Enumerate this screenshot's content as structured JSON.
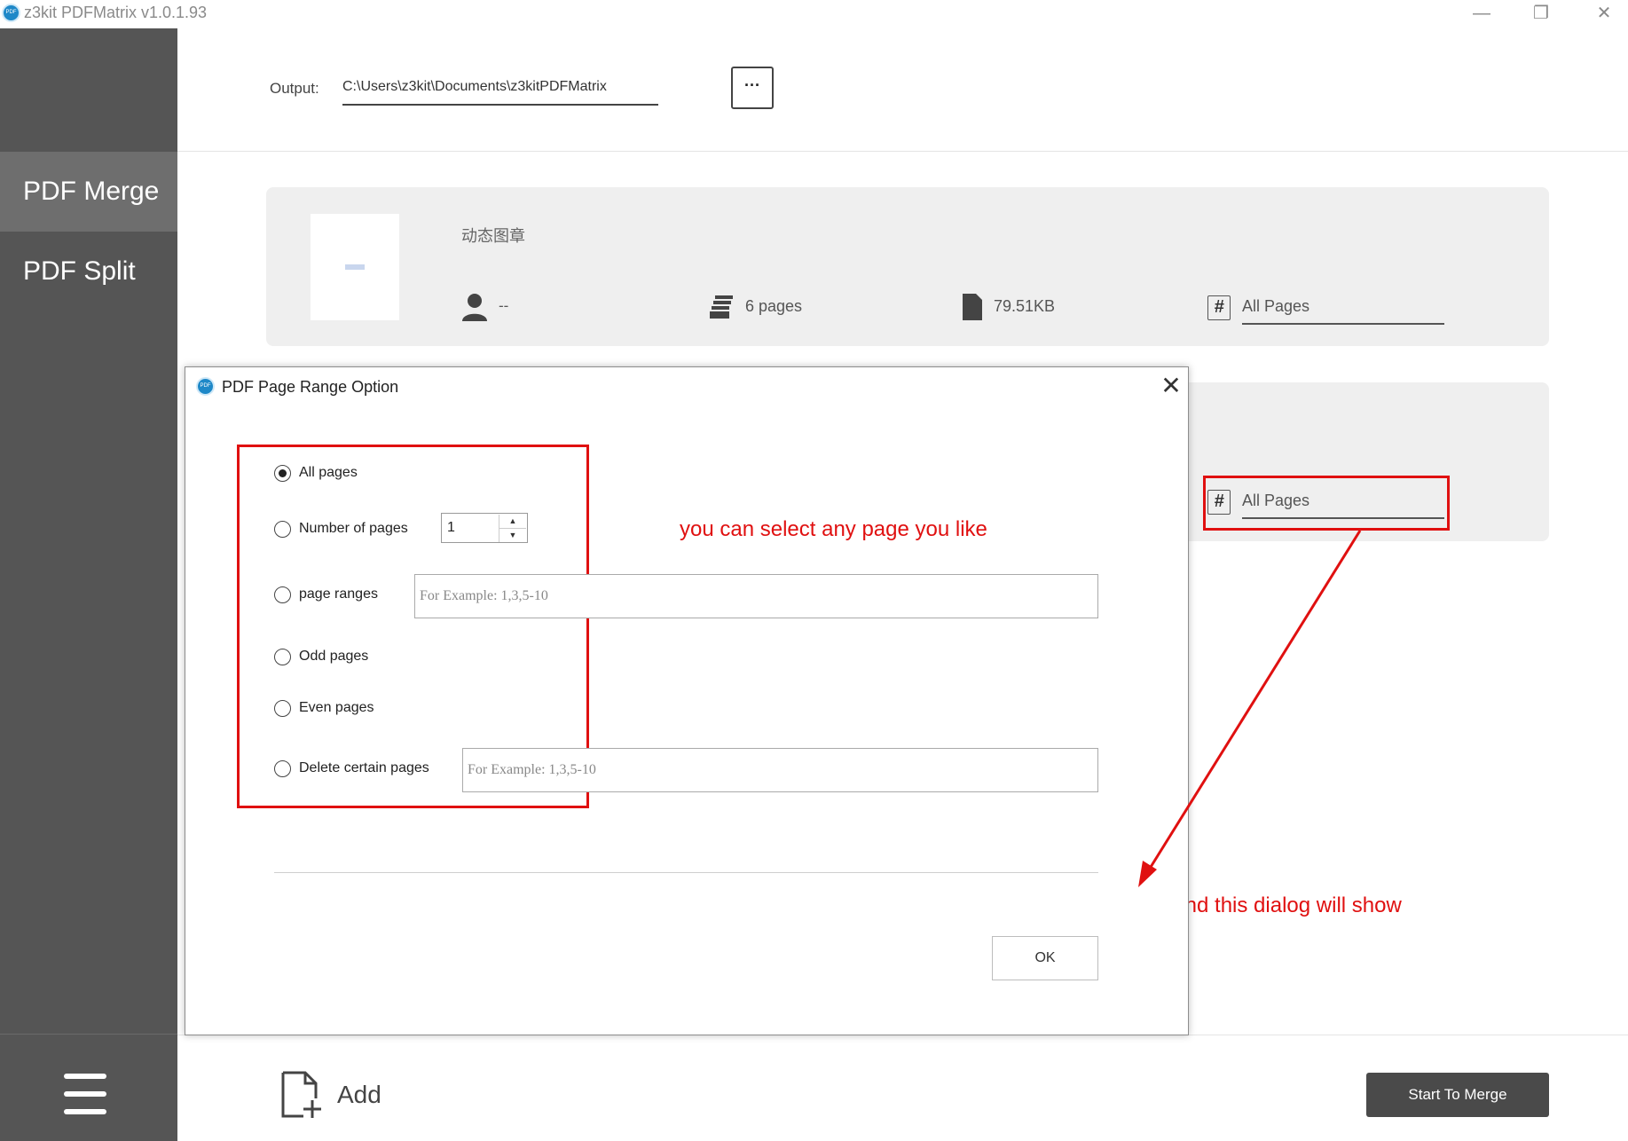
{
  "window": {
    "title": "z3kit PDFMatrix v1.0.1.93",
    "logo_text": "PDF",
    "minimize": "—",
    "restore": "❐",
    "close": "✕"
  },
  "sidebar": {
    "items": [
      {
        "label": "PDF Merge",
        "active": true
      },
      {
        "label": "PDF Split",
        "active": false
      }
    ]
  },
  "output": {
    "label": "Output:",
    "path": "C:\\Users\\z3kit\\Documents\\z3kitPDFMatrix",
    "browse_label": "···"
  },
  "files": [
    {
      "name": "动态图章",
      "author": "--",
      "pages": "6 pages",
      "size": "79.51KB",
      "range": "All Pages"
    },
    {
      "range": "All Pages"
    }
  ],
  "bottom": {
    "add_label": "Add",
    "start_label": "Start To Merge"
  },
  "dialog": {
    "title": "PDF Page Range Option",
    "close": "✕",
    "options": [
      {
        "label": "All pages",
        "selected": true
      },
      {
        "label": "Number of pages",
        "selected": false
      },
      {
        "label": "page ranges",
        "selected": false
      },
      {
        "label": "Odd pages",
        "selected": false
      },
      {
        "label": "Even pages",
        "selected": false
      },
      {
        "label": "Delete certain pages",
        "selected": false
      }
    ],
    "number_value": "1",
    "spin_up": "▲",
    "spin_down": "▼",
    "range_placeholder": "For Example: 1,3,5-10",
    "delete_placeholder": "For Example: 1,3,5-10",
    "ok_label": "OK"
  },
  "annotations": {
    "select_note": "you can select any page you like",
    "dialog_note": "click and this dialog will show",
    "color": "#e01010"
  },
  "icons": {
    "author": "user-icon",
    "pages": "stack-icon",
    "size": "file-icon",
    "range": "hash-file-icon",
    "add": "add-file-icon",
    "menu": "hamburger-icon"
  }
}
